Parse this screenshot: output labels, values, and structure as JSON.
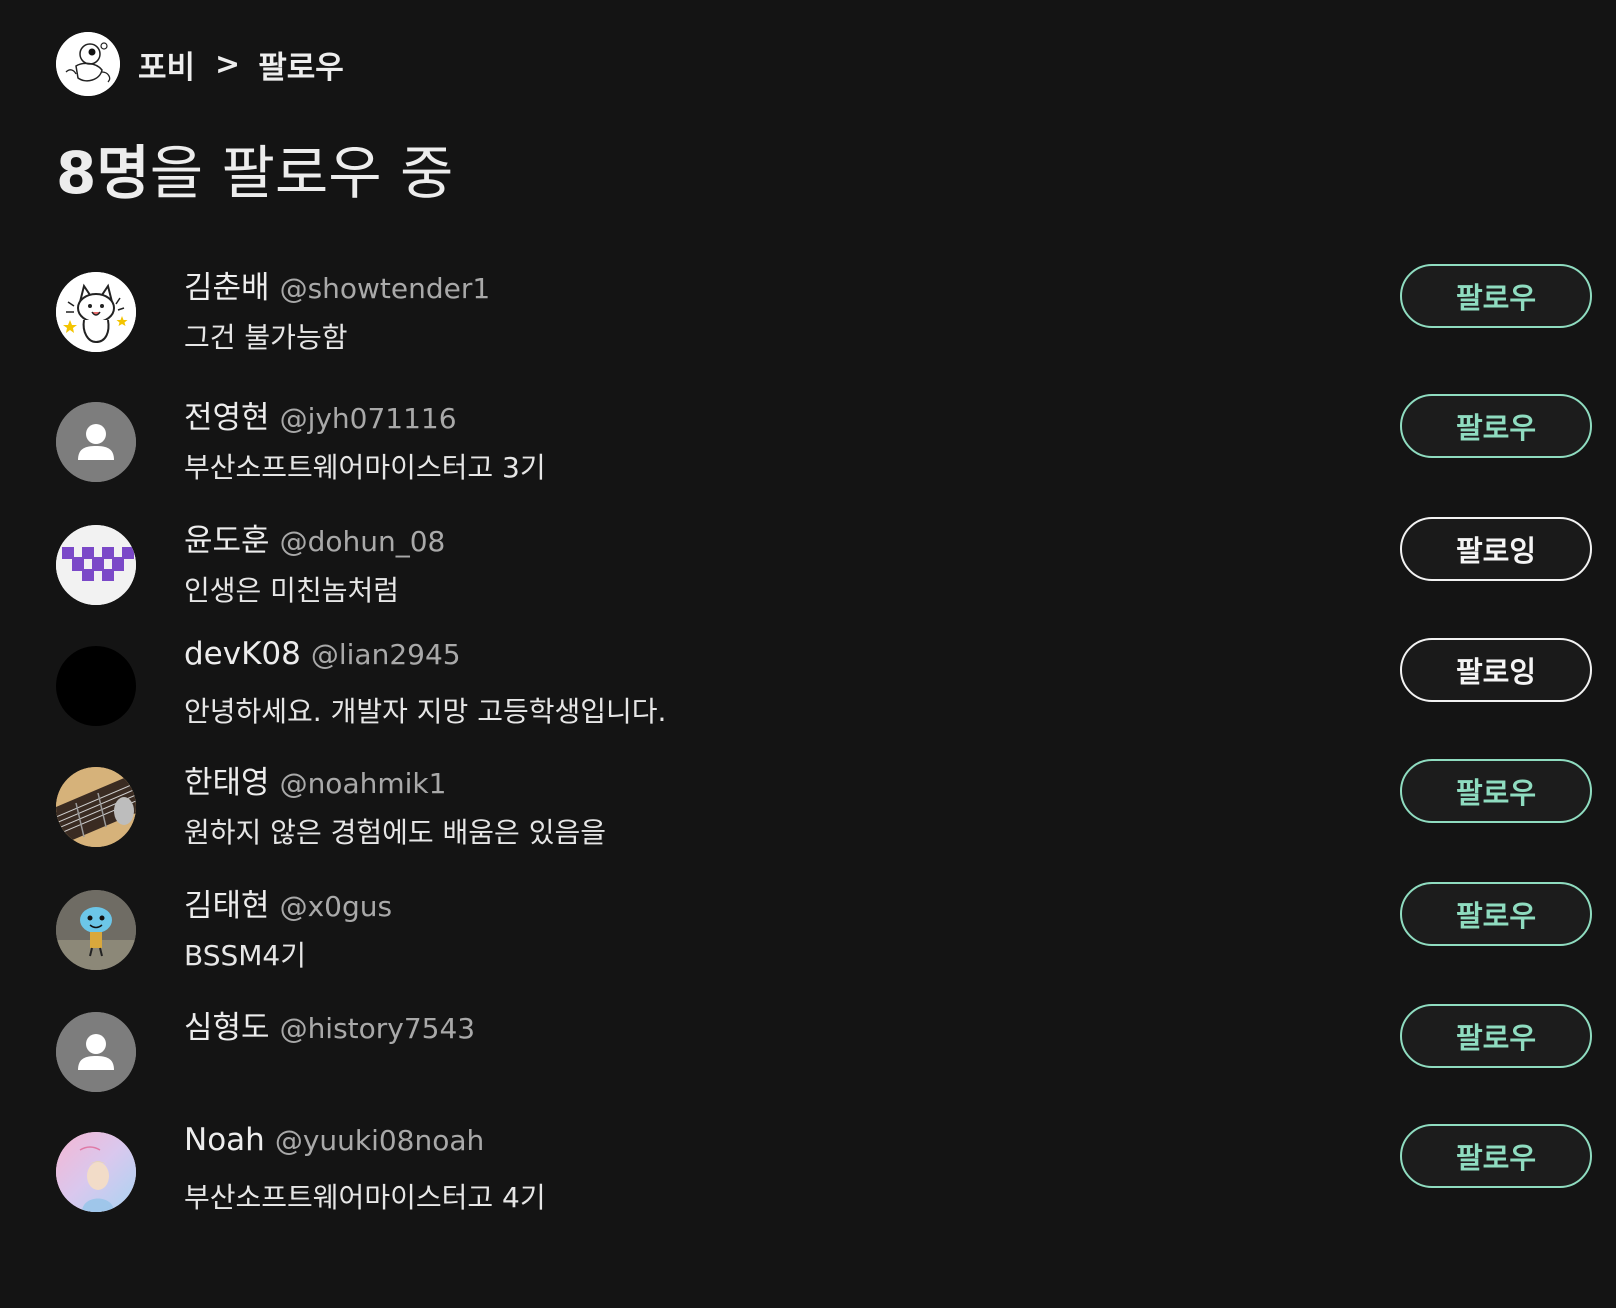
{
  "header": {
    "owner_name": "포비",
    "separator": ">",
    "page_name": "팔로우"
  },
  "title": {
    "count": "8명",
    "rest": "을 팔로우 중"
  },
  "users": [
    {
      "name": "김춘배",
      "handle": "@showtender1",
      "bio": "그건 불가능함",
      "button": "팔로우",
      "following": false,
      "avatar": "cat-illustration"
    },
    {
      "name": "전영현",
      "handle": "@jyh071116",
      "bio": "부산소프트웨어마이스터고 3기",
      "button": "팔로우",
      "following": false,
      "avatar": "default-person"
    },
    {
      "name": "윤도훈",
      "handle": "@dohun_08",
      "bio": "인생은 미친놈처럼",
      "button": "팔로잉",
      "following": true,
      "avatar": "purple-pattern"
    },
    {
      "name": "devK08",
      "handle": "@lian2945",
      "bio": "안녕하세요. 개발자 지망 고등학생입니다.",
      "button": "팔로잉",
      "following": true,
      "avatar": "black"
    },
    {
      "name": "한태영",
      "handle": "@noahmik1",
      "bio": "원하지 않은 경험에도 배움은 있음을",
      "button": "팔로우",
      "following": false,
      "avatar": "guitar-photo"
    },
    {
      "name": "김태현",
      "handle": "@x0gus",
      "bio": "BSSM4기",
      "button": "팔로우",
      "following": false,
      "avatar": "blue-character-photo"
    },
    {
      "name": "심형도",
      "handle": "@history7543",
      "bio": "",
      "button": "팔로우",
      "following": false,
      "avatar": "default-person"
    },
    {
      "name": "Noah",
      "handle": "@yuuki08noah",
      "bio": "부산소프트웨어마이스터고 4기",
      "button": "팔로우",
      "following": false,
      "avatar": "pastel-album-cover"
    }
  ],
  "colors": {
    "background": "#141414",
    "accent": "#8fdcc0",
    "following_border": "#f2f2f2"
  }
}
